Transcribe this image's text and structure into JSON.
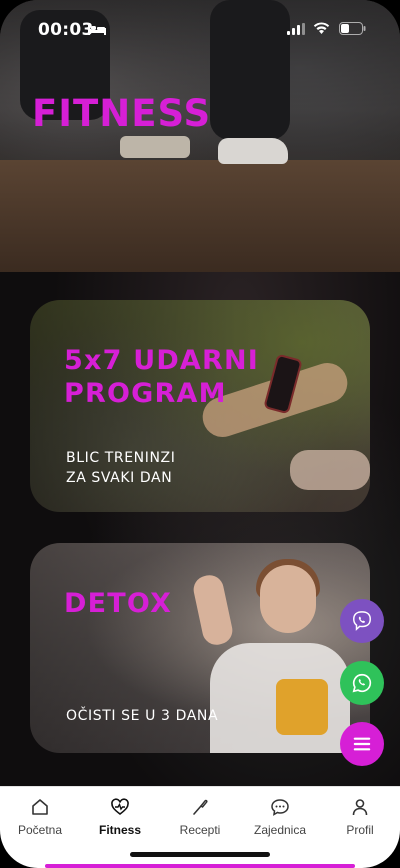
{
  "status_bar": {
    "time": "00:03"
  },
  "hero": {
    "title": "FITNESS"
  },
  "cards": [
    {
      "title_line1": "5x7 UDARNI",
      "title_line2": "PROGRAM",
      "subtitle_line1": "BLIC TRENINZI",
      "subtitle_line2": "ZA SVAKI DAN"
    },
    {
      "title_line1": "DETOX",
      "subtitle_line1": "OČISTI SE U 3 DANA"
    }
  ],
  "fabs": {
    "viber": "viber-icon",
    "whatsapp": "whatsapp-icon",
    "menu": "menu-icon"
  },
  "tabs": [
    {
      "label": "Početna",
      "icon": "home-icon"
    },
    {
      "label": "Fitness",
      "icon": "heart-pulse-icon",
      "active": true
    },
    {
      "label": "Recepti",
      "icon": "spatula-icon"
    },
    {
      "label": "Zajednica",
      "icon": "chat-icon"
    },
    {
      "label": "Profil",
      "icon": "person-icon"
    }
  ],
  "colors": {
    "accent": "#d61fd6",
    "viber": "#7d51c1",
    "whatsapp": "#2fc25a"
  }
}
